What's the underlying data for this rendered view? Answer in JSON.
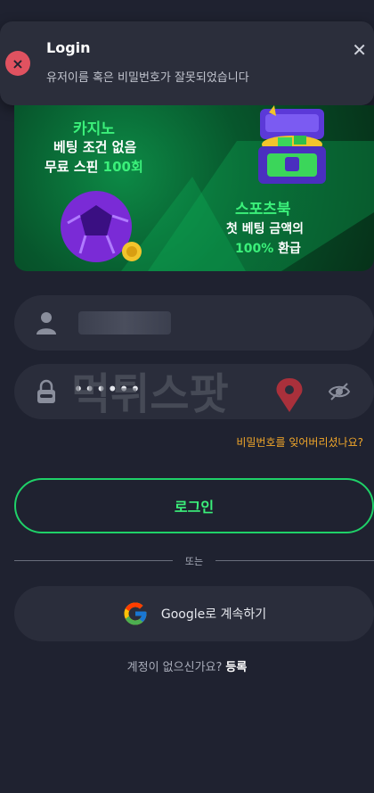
{
  "toast": {
    "title": "Login",
    "message": "유저이름 혹은 비밀번호가 잘못되었습니다",
    "close": "✕",
    "error_icon": "×",
    "accent": "#e05260"
  },
  "banner": {
    "casino_title": "카지노",
    "casino_line1": "베팅 조건 없음",
    "casino_line2_prefix": "무료 스핀",
    "casino_line2_highlight": "100회",
    "sports_title": "스포츠북",
    "sports_line1": "첫 베팅 금액의",
    "sports_line2_highlight": "100%",
    "sports_line2_suffix": "환급",
    "accent": "#3bf07a"
  },
  "form": {
    "username_icon": "user-icon",
    "password_icon": "lock-icon",
    "password_dots": "••••••",
    "visibility_icon": "eye-off-icon",
    "watermark": "먹튀스팟",
    "forgot": "비밀번호를 잊어버리셨나요?",
    "login": "로그인"
  },
  "divider": {
    "text": "또는"
  },
  "google": {
    "icon": "google-icon",
    "label": "Google로 계속하기"
  },
  "signup": {
    "prompt": "계정이 없으신가요?",
    "link": "등록"
  },
  "colors": {
    "background": "#1f2230",
    "field": "#2a2d3b",
    "green": "#1fd168",
    "orange": "#f3a82a"
  }
}
